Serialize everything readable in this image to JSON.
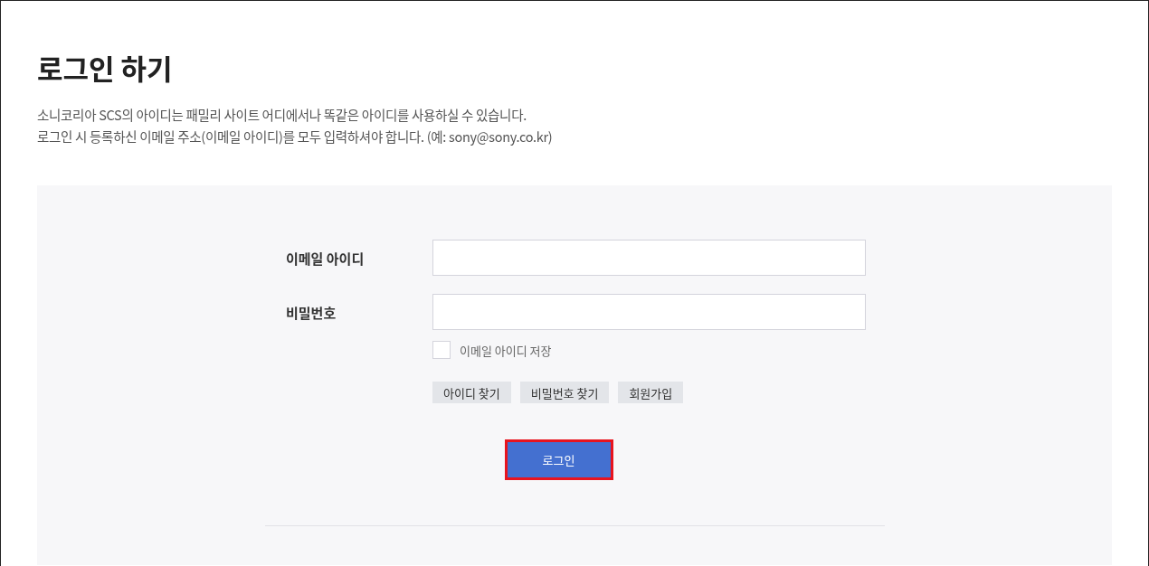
{
  "title": "로그인 하기",
  "description": [
    "소니코리아 SCS의 아이디는 패밀리 사이트 어디에서나 똑같은 아이디를 사용하실 수 있습니다.",
    "로그인 시 등록하신 이메일 주소(이메일 아이디)를 모두 입력하셔야 합니다. (예: sony@sony.co.kr)"
  ],
  "form": {
    "fields": [
      {
        "label": "이메일 아이디"
      },
      {
        "label": "비밀번호"
      }
    ],
    "remember": {
      "label": "이메일 아이디 저장",
      "checked": false
    },
    "links": [
      "아이디 찾기",
      "비밀번호 찾기",
      "회원가입"
    ],
    "submit": {
      "label": "로그인",
      "highlighted": true
    }
  }
}
